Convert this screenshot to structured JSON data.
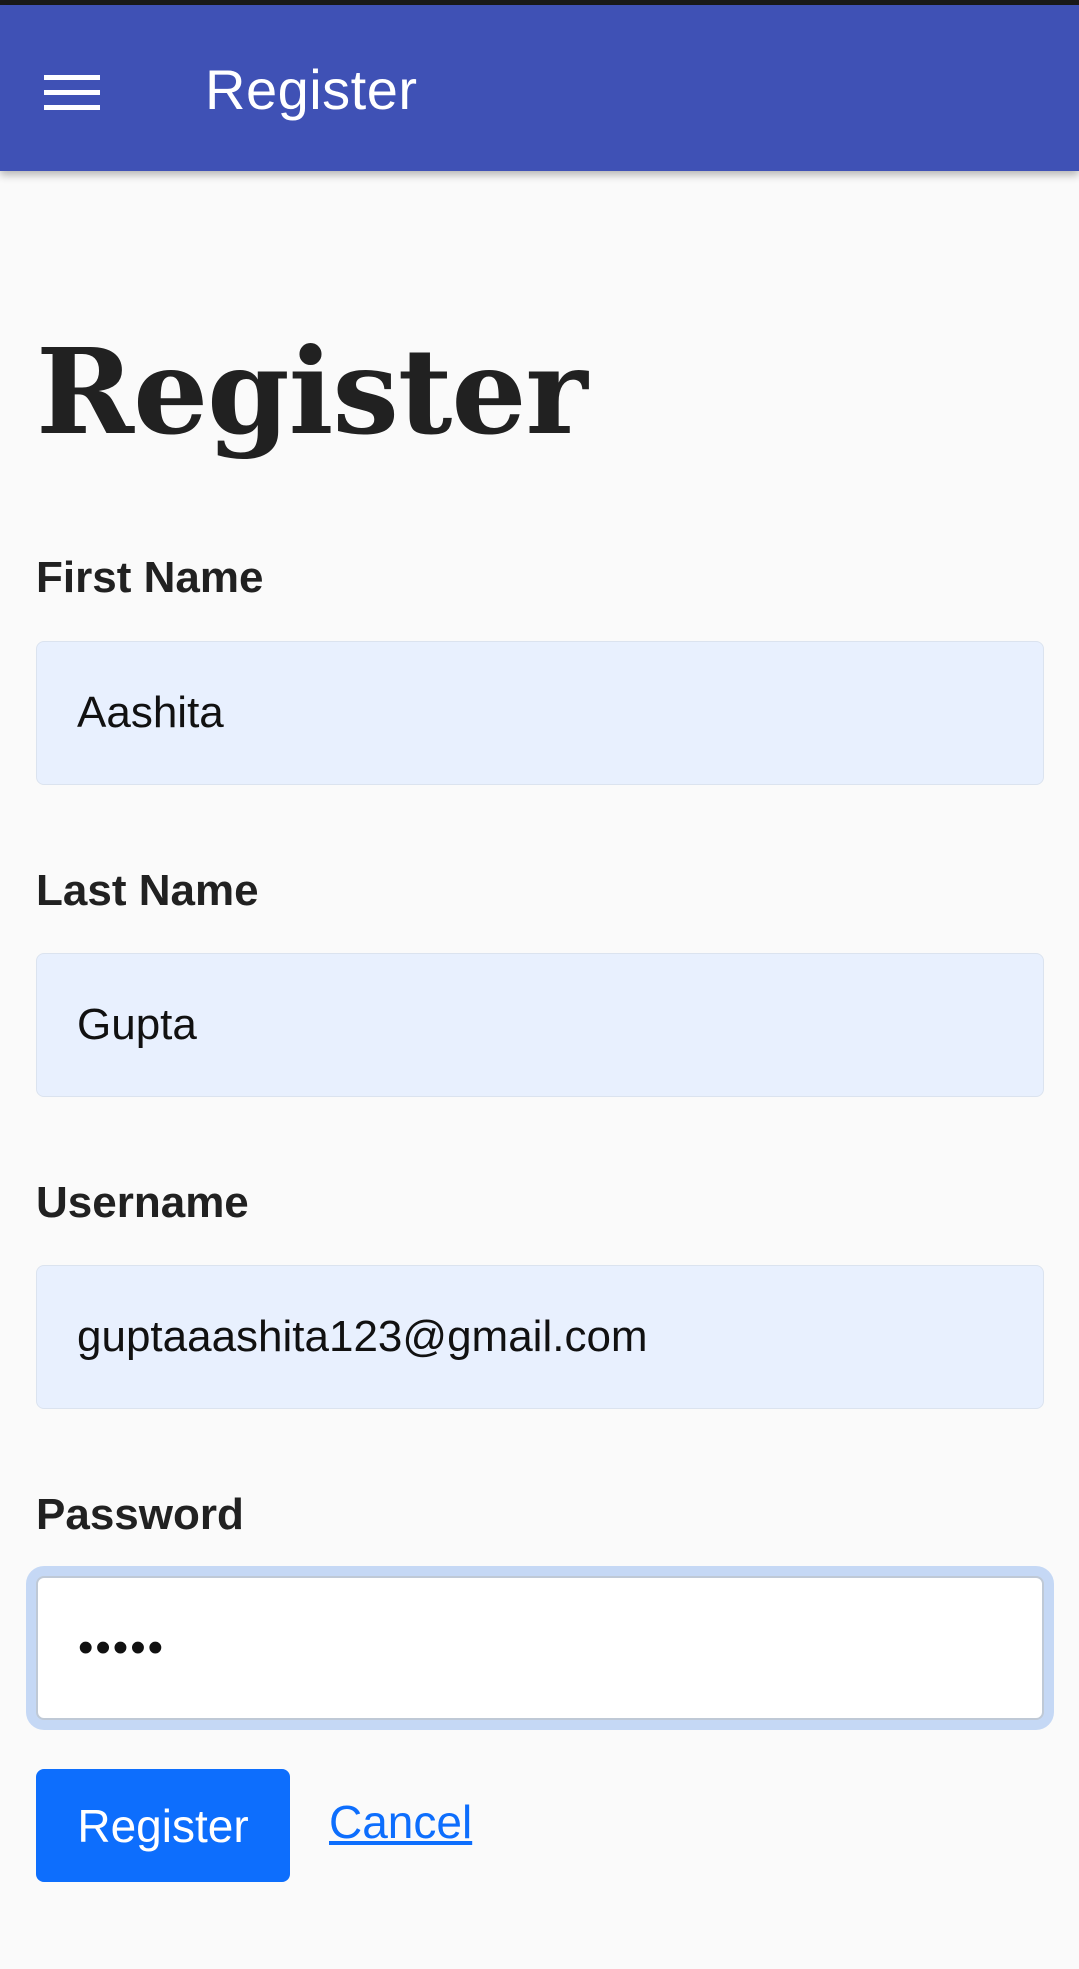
{
  "appbar": {
    "title": "Register",
    "menu_icon": "hamburger-menu-icon",
    "background_color": "#3f51b5"
  },
  "page": {
    "heading": "Register"
  },
  "form": {
    "first_name": {
      "label": "First Name",
      "value": "Aashita"
    },
    "last_name": {
      "label": "Last Name",
      "value": "Gupta"
    },
    "username": {
      "label": "Username",
      "value": "guptaaashita123@gmail.com"
    },
    "password": {
      "label": "Password",
      "value": "•••••"
    }
  },
  "actions": {
    "register_label": "Register",
    "cancel_label": "Cancel",
    "primary_color": "#0d6efd"
  }
}
